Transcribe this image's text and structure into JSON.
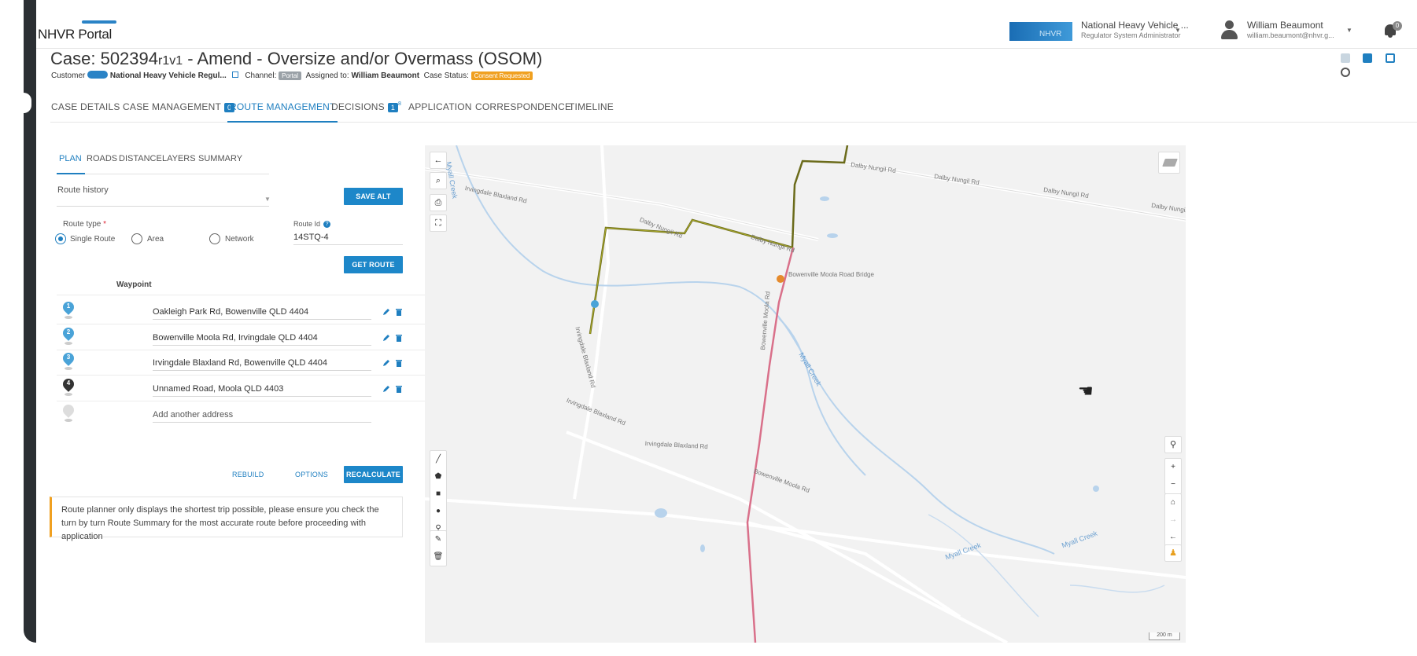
{
  "header": {
    "logo_text": "NHVR Portal",
    "org_name": "National Heavy Vehicle ...",
    "org_role": "Regulator System Administrator",
    "org_logo_text": "NHVR",
    "user_name": "William Beaumont",
    "user_email": "william.beaumont@nhvr.g...",
    "notification_count": "0"
  },
  "case": {
    "title_prefix": "Case: 502394",
    "revision": "r1v1",
    "title_suffix": " - Amend - Oversize and/or Overmass (OSOM)",
    "customer_label": "Customer",
    "customer_name": "National Heavy Vehicle Regul...",
    "channel_label": "Channel:",
    "channel_value": "Portal",
    "assigned_label": "Assigned to:",
    "assigned_value": "William Beaumont",
    "status_label": "Case Status:",
    "status_value": "Consent Requested"
  },
  "tabs": [
    {
      "label": "CASE DETAILS"
    },
    {
      "label": "CASE MANAGEMENT",
      "badge": "0"
    },
    {
      "label": "ROUTE MANAGEMENT"
    },
    {
      "label": "DECISIONS",
      "badge": "1",
      "sup": "8"
    },
    {
      "label": "APPLICATION"
    },
    {
      "label": "CORRESPONDENCE"
    },
    {
      "label": "TIMELINE"
    }
  ],
  "subtabs": [
    "PLAN",
    "ROADS",
    "DISTANCE",
    "LAYERS",
    "SUMMARY"
  ],
  "plan": {
    "route_history_label": "Route history",
    "save_alt": "SAVE ALT",
    "route_type_label": "Route type",
    "required_mark": "*",
    "route_types": [
      "Single Route",
      "Area",
      "Network"
    ],
    "route_id_label": "Route Id",
    "route_id_value": "14STQ-4",
    "get_route": "GET ROUTE",
    "waypoint_header": "Waypoint",
    "waypoints": [
      {
        "num": "1",
        "address": "Oakleigh Park Rd, Bowenville QLD 4404",
        "color": "#4aa3d8"
      },
      {
        "num": "2",
        "address": "Bowenville Moola Rd, Irvingdale QLD 4404",
        "color": "#4aa3d8"
      },
      {
        "num": "3",
        "address": "Irvingdale Blaxland Rd, Bowenville QLD 4404",
        "color": "#4aa3d8"
      },
      {
        "num": "4",
        "address": "Unnamed Road, Moola QLD 4403",
        "color": "#333333"
      }
    ],
    "add_address_placeholder": "Add another address",
    "rebuild": "REBUILD",
    "options": "OPTIONS",
    "recalculate": "RECALCULATE",
    "notice": "Route planner only displays the shortest trip possible, please ensure you check the turn by turn Route Summary for the most accurate route before proceeding with application"
  },
  "map": {
    "labels": {
      "myall_creek_1": "Myall Creek",
      "myall_creek_2": "Myall Creek",
      "myall_creek_3": "Myall Creek",
      "myall_creek_4": "Myall Creek",
      "dalby_nungil_1": "Dalby Nungil Rd",
      "dalby_nungil_2": "Dalby Nungil Rd",
      "dalby_nungil_3": "Dalby Nungil Rd",
      "dalby_nungil_4": "Dalby Nungil Rd",
      "dalby_nungil_5": "Dalby Nungil Rd",
      "dalby_nungil_6": "Dalby Nungil Rd",
      "irvingdale_blaxland_1": "Irvingdale Blaxland Rd",
      "irvingdale_blaxland_2": "Irvingdale Blaxland Rd",
      "irvingdale_blaxland_3": "Irvingdale Blaxland Rd",
      "irvingdale_blaxland_4": "Irvingdale Blaxland Rd",
      "bowenville_moola_1": "Bowenville Moola Rd",
      "bowenville_moola_2": "Bowenville Moola Rd",
      "bowenville_moola_bridge": "Bowenville Moola Road Bridge",
      "scale": "200 m"
    },
    "route_colors": {
      "route": "#6b6b1a",
      "highlight": "#c8c830",
      "main_road": "#d9708a"
    },
    "water_color": "#a9cbe8"
  }
}
